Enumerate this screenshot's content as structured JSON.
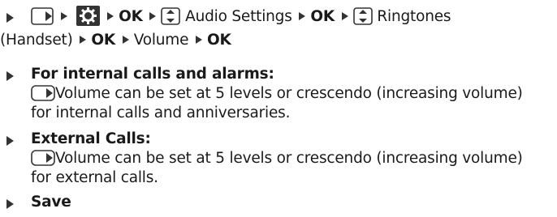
{
  "colors": {
    "text": "#1a1a1a",
    "icon_dark": "#333333",
    "key_fill": "#ffffff"
  },
  "step1": {
    "icons": [
      "menu-key-icon",
      "gear-icon",
      "navigation-key-icon"
    ],
    "ok_1": "OK",
    "audio_settings": "Audio Settings",
    "ok_2": "OK",
    "ringtones": "Ringtones",
    "handset": "(Handset)",
    "ok_3": "OK",
    "volume": "Volume",
    "ok_4": "OK"
  },
  "step2": {
    "title": "For internal calls and alarms:",
    "line1": "Volume can be set at 5 levels or crescendo (increasing volume)",
    "line2": "for internal calls and anniversaries."
  },
  "step3": {
    "title": "External Calls:",
    "line1": "Volume can be set at 5 levels or crescendo (increasing volume)",
    "line2": "for external calls."
  },
  "step4": {
    "title": "Save"
  }
}
